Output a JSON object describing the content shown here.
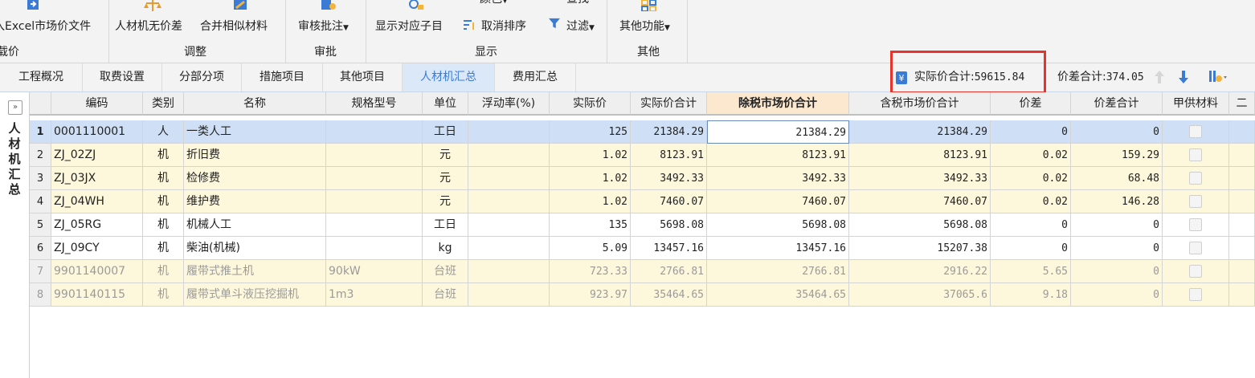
{
  "ribbon": {
    "groups": [
      {
        "label": "载价",
        "buttons": [
          {
            "label": "入Excel市场价文件"
          }
        ]
      },
      {
        "label": "调整",
        "buttons": [
          {
            "label": "人材机无价差"
          },
          {
            "label": "合并相似材料"
          }
        ]
      },
      {
        "label": "审批",
        "buttons": [
          {
            "label": "审核批注"
          }
        ]
      },
      {
        "label": "显示",
        "buttons": [
          {
            "label": "显示对应子目"
          },
          {
            "label": "颜色"
          },
          {
            "label": "取消排序"
          },
          {
            "label": "查找"
          },
          {
            "label": "过滤"
          }
        ]
      },
      {
        "label": "其他",
        "buttons": [
          {
            "label": "其他功能"
          }
        ]
      }
    ]
  },
  "tabs": [
    "工程概况",
    "取费设置",
    "分部分项",
    "措施项目",
    "其他项目",
    "人材机汇总",
    "费用汇总"
  ],
  "active_tab": "人材机汇总",
  "summary": {
    "actual_label": "实际价合计:",
    "actual_value": "59615.84",
    "diff_label": "价差合计:",
    "diff_value": "374.05"
  },
  "side_panel": {
    "title_chars": [
      "人",
      "材",
      "机",
      "汇",
      "总"
    ],
    "expand_symbol": "»"
  },
  "table": {
    "columns": [
      "编码",
      "类别",
      "名称",
      "规格型号",
      "单位",
      "浮动率(%)",
      "实际价",
      "实际价合计",
      "除税市场价合计",
      "含税市场价合计",
      "价差",
      "价差合计",
      "甲供材料",
      "二"
    ],
    "rows": [
      {
        "no": "1",
        "code": "0001110001",
        "type": "人",
        "name": "一类人工",
        "spec": "",
        "unit": "工日",
        "float": "",
        "price": "125",
        "price_total": "21384.29",
        "ex_tax": "21384.29",
        "inc_tax": "21384.29",
        "diff": "0",
        "diff_total": "0"
      },
      {
        "no": "2",
        "code": "ZJ_02ZJ",
        "type": "机",
        "name": "折旧费",
        "spec": "",
        "unit": "元",
        "float": "",
        "price": "1.02",
        "price_total": "8123.91",
        "ex_tax": "8123.91",
        "inc_tax": "8123.91",
        "diff": "0.02",
        "diff_total": "159.29"
      },
      {
        "no": "3",
        "code": "ZJ_03JX",
        "type": "机",
        "name": "检修费",
        "spec": "",
        "unit": "元",
        "float": "",
        "price": "1.02",
        "price_total": "3492.33",
        "ex_tax": "3492.33",
        "inc_tax": "3492.33",
        "diff": "0.02",
        "diff_total": "68.48"
      },
      {
        "no": "4",
        "code": "ZJ_04WH",
        "type": "机",
        "name": "维护费",
        "spec": "",
        "unit": "元",
        "float": "",
        "price": "1.02",
        "price_total": "7460.07",
        "ex_tax": "7460.07",
        "inc_tax": "7460.07",
        "diff": "0.02",
        "diff_total": "146.28"
      },
      {
        "no": "5",
        "code": "ZJ_05RG",
        "type": "机",
        "name": "机械人工",
        "spec": "",
        "unit": "工日",
        "float": "",
        "price": "135",
        "price_total": "5698.08",
        "ex_tax": "5698.08",
        "inc_tax": "5698.08",
        "diff": "0",
        "diff_total": "0"
      },
      {
        "no": "6",
        "code": "ZJ_09CY",
        "type": "机",
        "name": "柴油(机械)",
        "spec": "",
        "unit": "kg",
        "float": "",
        "price": "5.09",
        "price_total": "13457.16",
        "ex_tax": "13457.16",
        "inc_tax": "15207.38",
        "diff": "0",
        "diff_total": "0"
      },
      {
        "no": "7",
        "code": "9901140007",
        "type": "机",
        "name": "履带式推土机",
        "spec": "90kW",
        "unit": "台班",
        "float": "",
        "price": "723.33",
        "price_total": "2766.81",
        "ex_tax": "2766.81",
        "inc_tax": "2916.22",
        "diff": "5.65",
        "diff_total": "0"
      },
      {
        "no": "8",
        "code": "9901140115",
        "type": "机",
        "name": "履带式单斗液压挖掘机",
        "spec": "1m3",
        "unit": "台班",
        "float": "",
        "price": "923.97",
        "price_total": "35464.65",
        "ex_tax": "35464.65",
        "inc_tax": "37065.6",
        "diff": "9.18",
        "diff_total": "0"
      }
    ]
  },
  "colors": {
    "accent": "#3a7bd5",
    "highlight_red": "#e8322c",
    "row_yellow": "#fdf8dc",
    "selected_row": "#cfe0f6"
  }
}
